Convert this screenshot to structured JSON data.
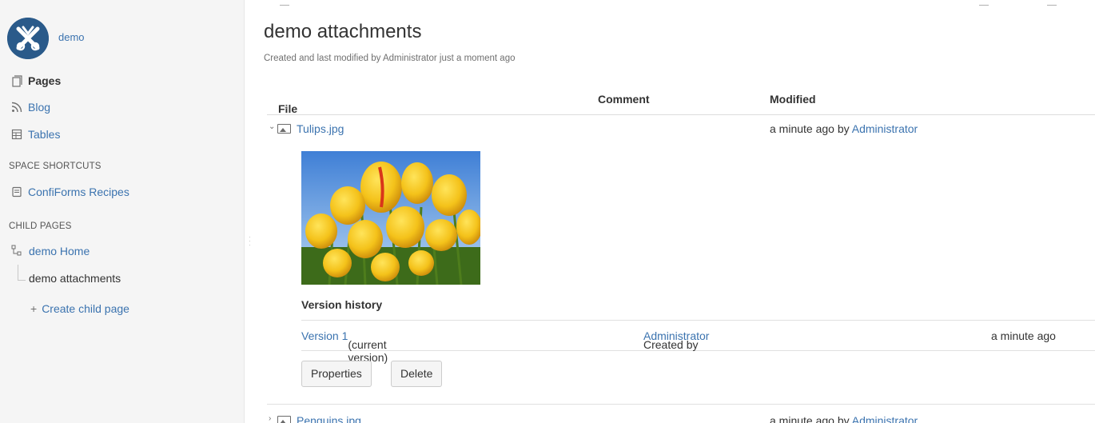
{
  "sidebar": {
    "space_name": "demo",
    "nav": {
      "pages": "Pages",
      "blog": "Blog",
      "tables": "Tables"
    },
    "space_shortcuts_heading": "SPACE SHORTCUTS",
    "shortcuts": [
      "ConfiForms Recipes"
    ],
    "child_pages_heading": "CHILD PAGES",
    "tree": {
      "home": "demo Home",
      "current": "demo attachments"
    },
    "create_child": "Create child page"
  },
  "page": {
    "title": "demo attachments",
    "meta": "Created and last modified by Administrator just a moment ago"
  },
  "attachments": {
    "headers": {
      "file": "File",
      "comment": "Comment",
      "modified": "Modified"
    },
    "rows": [
      {
        "name": "Tulips.jpg",
        "modified_prefix": "a minute ago by ",
        "modified_by": "Administrator",
        "expanded": true
      },
      {
        "name": "Penguins.jpg",
        "modified_prefix": "a minute ago by ",
        "modified_by": "Administrator",
        "expanded": false
      }
    ],
    "version_history": {
      "title": "Version history",
      "version_link": "Version 1",
      "version_note": " (current version)",
      "created_prefix": "Created by ",
      "created_by": "Administrator",
      "when": "a minute ago"
    },
    "buttons": {
      "properties": "Properties",
      "delete": "Delete"
    }
  },
  "colors": {
    "link": "#3b73af",
    "sidebar_bg": "#f5f5f5",
    "logo_bg": "#2a5a8a"
  }
}
